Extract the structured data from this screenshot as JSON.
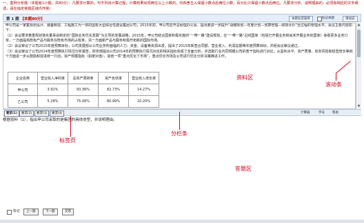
{
  "instructions": "一、案例分析题（本题有1小题，共80分）：凡要求计算的，可不列出计算过程；计算结果出现两位以上小数的，均四舍五入保留小数点后两位小数，百分比只保留小数点后两位。凡要求分析、说明理由的，必须有相应的文字阐述。请在指定答题区域内作答）",
  "question_header": {
    "number": "第 1 题",
    "score": "【本题80分】",
    "mark_button": "本题标签题目",
    "mark_checkbox_label": "标记本题",
    "extra": "增加说"
  },
  "material": {
    "paragraphs": [
      "甲公司是一家集规划设计、装备制造、工程施工为一体的国有大型综合性建设集团公司，2015年初，甲公司召开总经理办公会，提出要进一步提升“战略规划—年度计划—预算管理—绩效评价”全过程的管理水平。会议主要内容如下：",
      "（1）会议要求着重规划落实董事会制定的“国际业务优先发展”为主导的发展战略，2015年，甲公司结合国家积极实施的“一带一路”建设规划，在“一带一路”沿线国家（包括已开展业务和尚未开展业务的国家）争取更多业务订单，一方面提高既有产品与服务在既有市场的占有率，另一方面新产品与服务积极开拓新的国际市场。",
      "（2）会议审议了公司2015年度预算目标，公司发展部从公司业务所面临的人力、资金、设备等资源出发，提出了2015年新签合同额、营业收入、利润总额等年度预算目标，并经会议审议通过。",
      "（3）会议审议了公司2014年度预算执行情况分析报告，财务部提出公司2014年的预算执行情况对应的相关指标完成了全面分析，并选取行业内同规模公司的若干指标进行对比，从盈利水平、资产质量、债务风险和经营增长等四个方面进一步从鼓励和促进统一行动，资产规模指标（如按对值），其他一项“重点优化了市场”，重点优化市场及公司进行优化分析决策推进工作。"
    ],
    "table": {
      "headers": [
        "企业名称",
        "营业收入净利率",
        "总资产周转率",
        "资产负债率",
        "营业收入增长率"
      ],
      "rows": [
        [
          "甲公司",
          "3.91%",
          "93.36%",
          "82.73%",
          "14.27%"
        ],
        [
          "乙公司",
          "5.28%",
          "75.06%",
          "80.99%",
          "10.20%"
        ]
      ]
    }
  },
  "annotations": {
    "material_area": "资料区",
    "scrollbar": "滚动条",
    "tab_page": "标签页",
    "divider_bar": "分栏条",
    "answer_area": "答题区"
  },
  "tabs": [
    "要求(1)",
    "要求(2)",
    "要求(3)",
    "要求(4)"
  ],
  "toolbar": {
    "calculator": "计算器",
    "fontsize": "字号",
    "help": "帮助"
  },
  "question_text": "根据资料（1），指出甲公司采取的是集团的具体类型，并说明理由。",
  "footer": {
    "mark_label": "标记",
    "buttons": [
      "上一题",
      "下一题",
      "交卷"
    ]
  }
}
